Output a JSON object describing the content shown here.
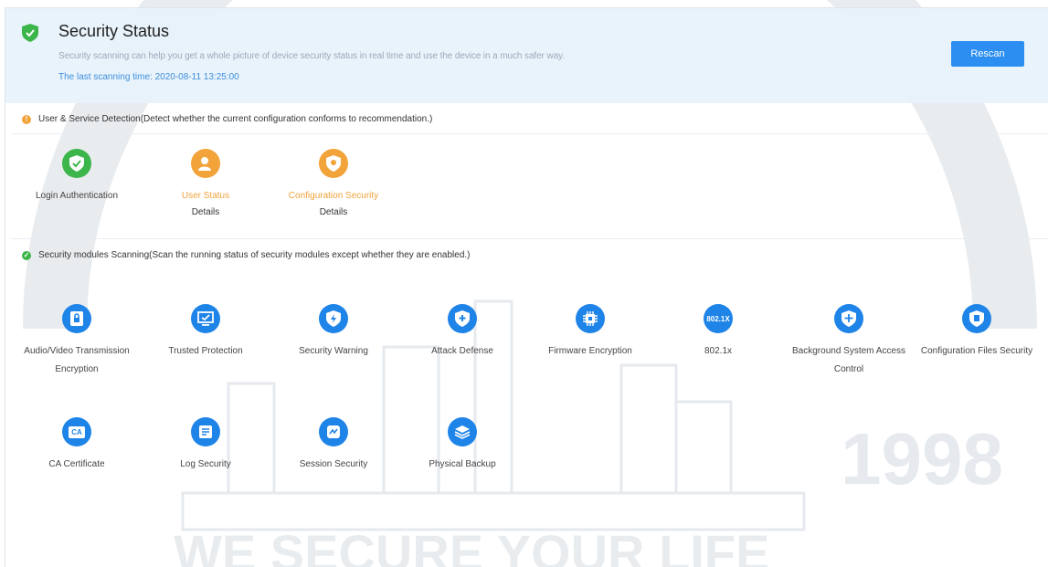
{
  "header": {
    "title": "Security Status",
    "subtitle": "Security scanning can help you get a whole picture of device security status in real time and use the device in a much safer way.",
    "last_scan": "The last scanning time: 2020-08-11 13:25:00",
    "rescan_label": "Rescan"
  },
  "user_service": {
    "heading": "User & Service Detection(Detect whether the current configuration conforms to recommendation.)",
    "items": [
      {
        "label": "Login Authentication",
        "status": "ok",
        "icon": "shield-check-icon"
      },
      {
        "label": "User Status",
        "status": "warning",
        "icon": "user-icon",
        "link": "Details"
      },
      {
        "label": "Configuration Security",
        "status": "warning",
        "icon": "config-shield-icon",
        "link": "Details"
      }
    ]
  },
  "modules": {
    "heading": "Security modules Scanning(Scan the running status of security modules except whether they are enabled.)",
    "items": [
      {
        "label": "Audio/Video Transmission Encryption",
        "icon": "av-lock-icon"
      },
      {
        "label": "Trusted Protection",
        "icon": "monitor-check-icon"
      },
      {
        "label": "Security Warning",
        "icon": "shield-bolt-icon"
      },
      {
        "label": "Attack Defense",
        "icon": "shield-plus-icon"
      },
      {
        "label": "Firmware Encryption",
        "icon": "chip-icon"
      },
      {
        "label": "802.1x",
        "icon": "badge-8021x-icon",
        "badge": "802.1X"
      },
      {
        "label": "Background System Access Control",
        "icon": "shield-cross-icon"
      },
      {
        "label": "Configuration Files Security",
        "icon": "file-shield-icon"
      },
      {
        "label": "CA Certificate",
        "icon": "certificate-icon",
        "badge": "CA"
      },
      {
        "label": "Log Security",
        "icon": "log-icon"
      },
      {
        "label": "Session Security",
        "icon": "session-icon"
      },
      {
        "label": "Physical Backup",
        "icon": "layers-icon"
      }
    ]
  },
  "watermark": {
    "text": "WE SECURE YOUR LIFE",
    "year": "1998"
  },
  "colors": {
    "ok": "#3cb54a",
    "warning": "#f2a33a",
    "module": "#1f84e8",
    "accent": "#2b8ef0"
  }
}
